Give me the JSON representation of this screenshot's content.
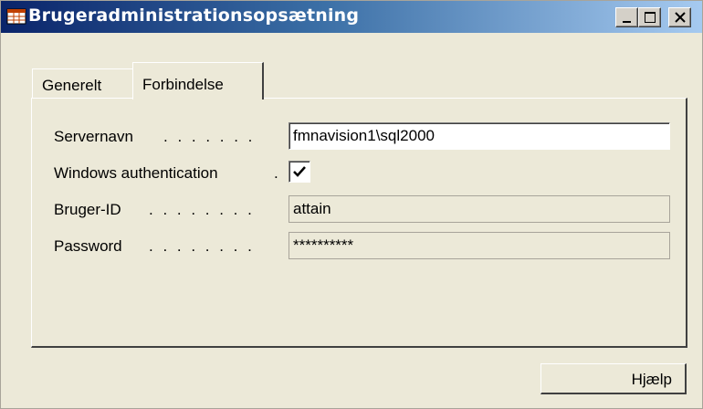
{
  "window": {
    "title": "Brugeradministrationsopsætning",
    "controls": {
      "minimize": "minimize-icon",
      "maximize": "maximize-icon",
      "close": "close-icon"
    }
  },
  "tabs": [
    {
      "label": "Generelt",
      "active": false
    },
    {
      "label": "Forbindelse",
      "active": true
    }
  ],
  "form": {
    "server_name": {
      "label": "Servernavn",
      "dots": ". . . . . . .",
      "value": "fmnavision1\\sql2000"
    },
    "windows_auth": {
      "label": "Windows authentication",
      "dots": ".",
      "checked": true
    },
    "user_id": {
      "label": "Bruger-ID",
      "dots": ". . . . . . . .",
      "value": "attain"
    },
    "password": {
      "label": "Password",
      "dots": ". . . . . . . .",
      "value": "**********"
    }
  },
  "buttons": {
    "help": "Hjælp"
  }
}
